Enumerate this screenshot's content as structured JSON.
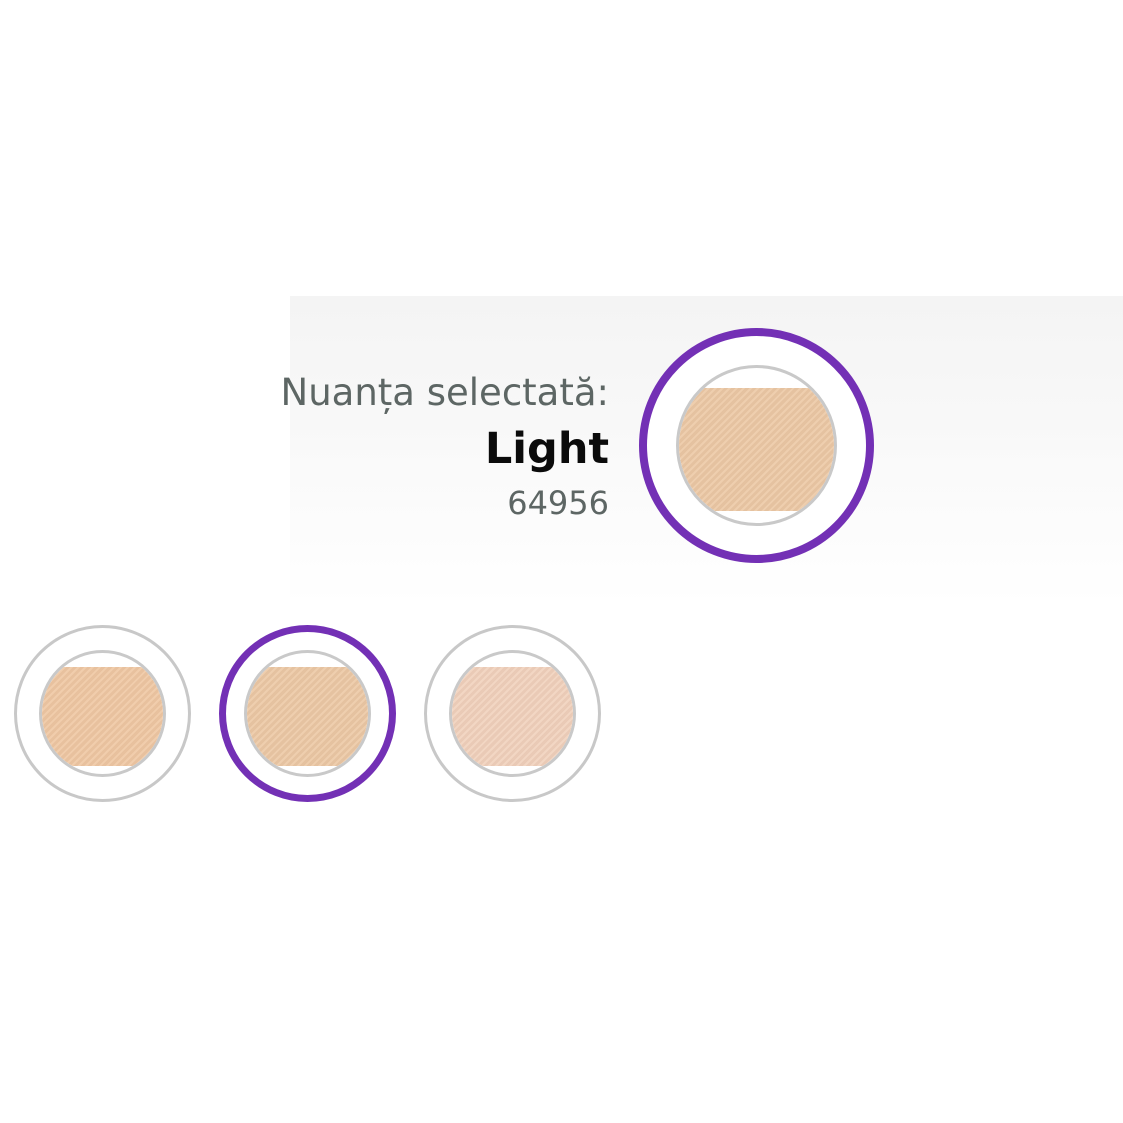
{
  "selection": {
    "label": "Nuanța selectată:",
    "shade_name": "Light",
    "shade_code": "64956",
    "swatch_color": "#ecc8a5"
  },
  "accent_color": "#7330b5",
  "swatches": [
    {
      "color": "#efc7a3",
      "selected": false
    },
    {
      "color": "#ecc8a5",
      "selected": true
    },
    {
      "color": "#f1d1bc",
      "selected": false
    }
  ]
}
